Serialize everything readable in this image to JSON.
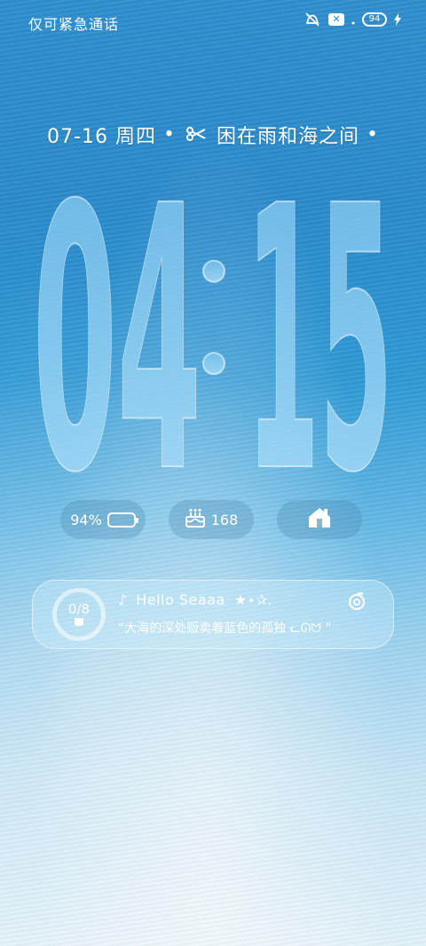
{
  "status_bar": {
    "carrier": "仅可紧急通话",
    "battery_level": "94",
    "icons": [
      "mute-icon",
      "sim-x-icon",
      "dot-icon",
      "battery-icon",
      "charging-bolt-icon"
    ]
  },
  "lockscreen": {
    "date_line": {
      "date": "07-16 周四",
      "separator": "•",
      "song_caption": "困在雨和海之间",
      "trail": "•"
    },
    "clock": {
      "hour": "04",
      "minute": "15",
      "colon": ":"
    },
    "widgets": {
      "battery": {
        "text": "94%",
        "level": 0.94
      },
      "birthday": {
        "text": "168"
      },
      "home": {
        "icon": "home-icon"
      }
    },
    "music_card": {
      "progress": "0/8",
      "note": "♪",
      "title": "Hello Seaaa",
      "stars": "★⋆✰.",
      "lyric": "“大海的深处贩卖着蓝色的孤独 ᓚᘏᗢ ”",
      "icon": "loop-icon"
    }
  },
  "colors": {
    "sea_top": "#2f8fcf",
    "sea_bottom": "#e3f3fb",
    "clock_fill": "#8fd0f5"
  }
}
